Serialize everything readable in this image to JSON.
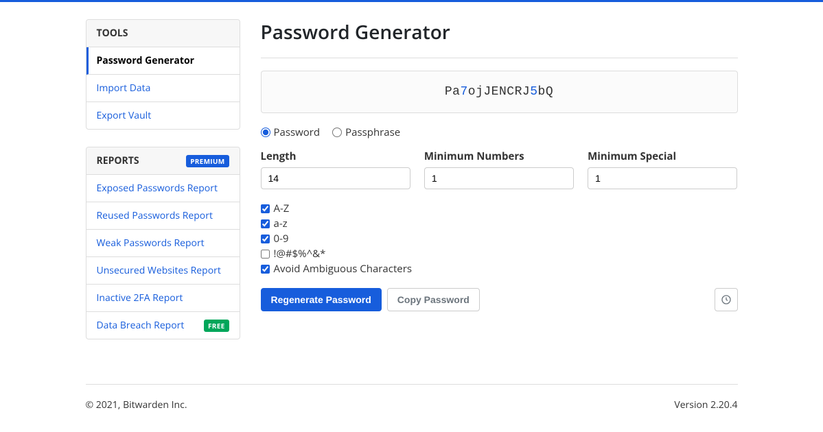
{
  "sidebar": {
    "tools": {
      "header": "TOOLS",
      "items": [
        {
          "label": "Password Generator",
          "active": true
        },
        {
          "label": "Import Data",
          "active": false
        },
        {
          "label": "Export Vault",
          "active": false
        }
      ]
    },
    "reports": {
      "header": "REPORTS",
      "header_badge": "PREMIUM",
      "items": [
        {
          "label": "Exposed Passwords Report"
        },
        {
          "label": "Reused Passwords Report"
        },
        {
          "label": "Weak Passwords Report"
        },
        {
          "label": "Unsecured Websites Report"
        },
        {
          "label": "Inactive 2FA Report"
        },
        {
          "label": "Data Breach Report",
          "badge": "FREE"
        }
      ]
    }
  },
  "page": {
    "title": "Password Generator",
    "generated_password_parts": [
      {
        "text": "Pa",
        "type": "letter"
      },
      {
        "text": "7",
        "type": "number"
      },
      {
        "text": "ojJENCRJ",
        "type": "letter"
      },
      {
        "text": "5",
        "type": "number"
      },
      {
        "text": "bQ",
        "type": "letter"
      }
    ],
    "type_options": {
      "password": "Password",
      "passphrase": "Passphrase",
      "selected": "password"
    },
    "fields": {
      "length": {
        "label": "Length",
        "value": "14"
      },
      "min_numbers": {
        "label": "Minimum Numbers",
        "value": "1"
      },
      "min_special": {
        "label": "Minimum Special",
        "value": "1"
      }
    },
    "checks": {
      "upper": {
        "label": "A-Z",
        "checked": true
      },
      "lower": {
        "label": "a-z",
        "checked": true
      },
      "numbers": {
        "label": "0-9",
        "checked": true
      },
      "special": {
        "label": "!@#$%^&*",
        "checked": false
      },
      "ambiguous": {
        "label": "Avoid Ambiguous Characters",
        "checked": true
      }
    },
    "buttons": {
      "regenerate": "Regenerate Password",
      "copy": "Copy Password",
      "history_icon": "history-icon"
    }
  },
  "footer": {
    "copyright": "© 2021, Bitwarden Inc.",
    "version": "Version 2.20.4"
  }
}
